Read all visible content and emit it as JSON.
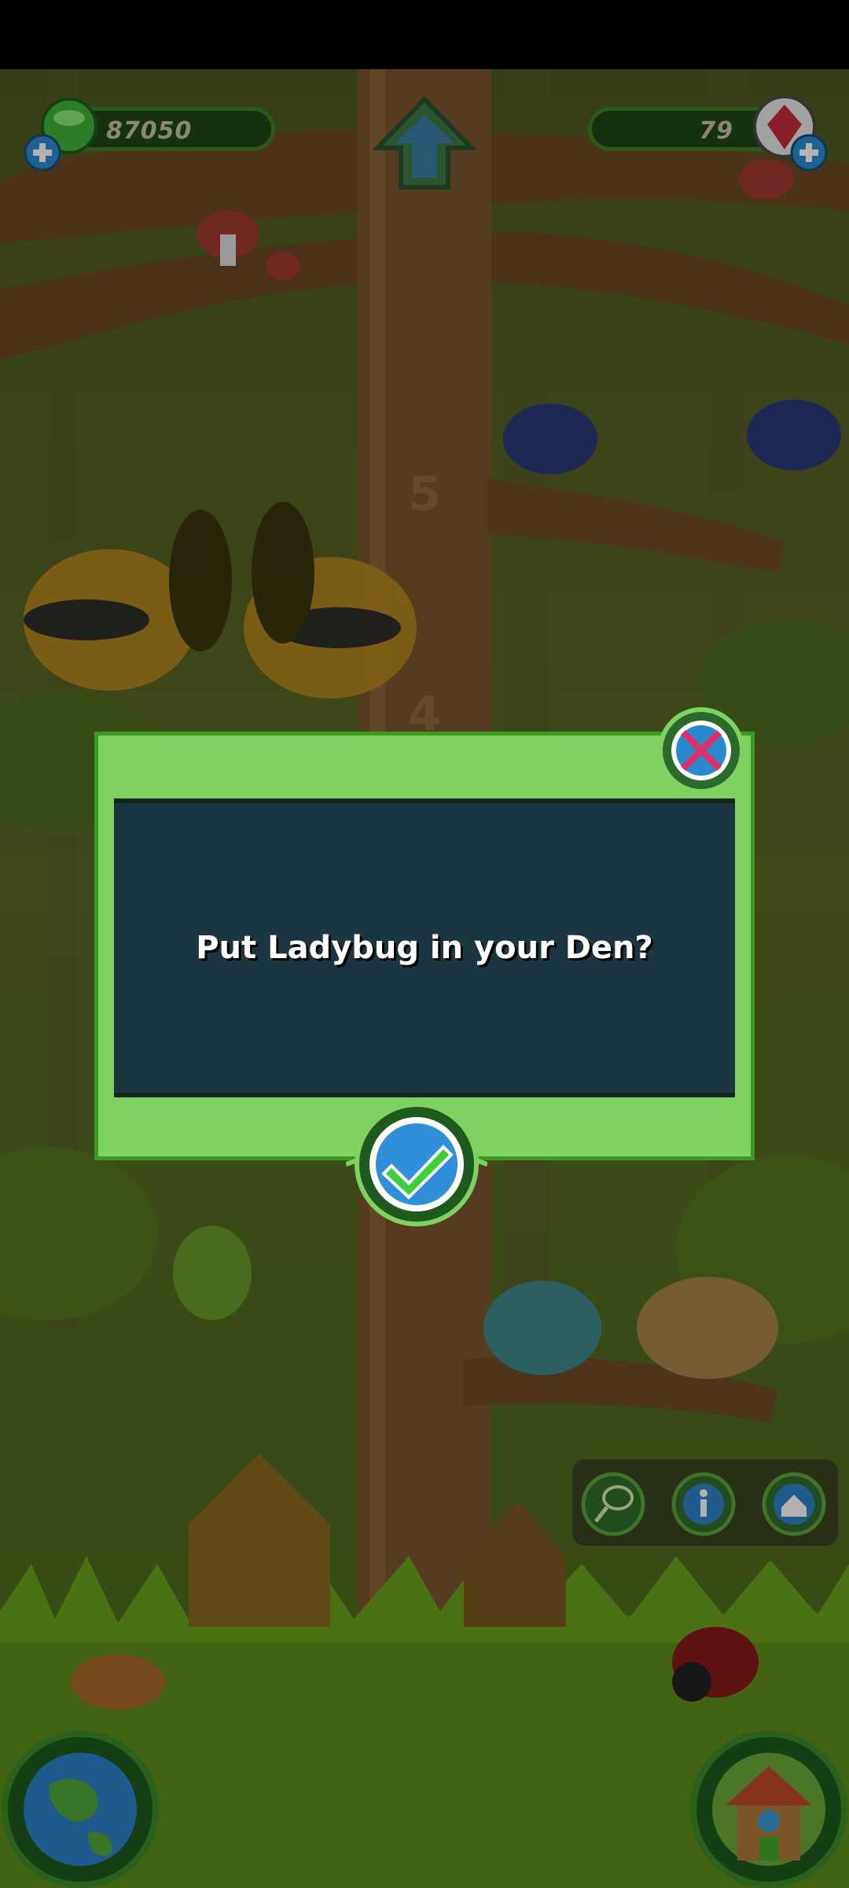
{
  "hud": {
    "coins": "87050",
    "gems": "79"
  },
  "scene": {
    "tree_level_top": "5",
    "tree_level_mid": "4"
  },
  "dialog": {
    "message": "Put Ladybug in your Den?"
  },
  "icons": {
    "coin": "green-coin-icon",
    "gem": "red-gem-icon",
    "add": "plus-icon",
    "up": "up-arrow-icon",
    "close": "close-x-icon",
    "confirm": "checkmark-icon",
    "net": "bug-net-icon",
    "info": "info-icon",
    "den": "den-house-icon",
    "globe": "globe-icon",
    "house": "treehouse-icon"
  },
  "colors": {
    "dialog_green": "#7fd262",
    "dialog_panel": "#1b3640",
    "close_pink": "#e0306a",
    "confirm_blue": "#2f8fd8"
  }
}
